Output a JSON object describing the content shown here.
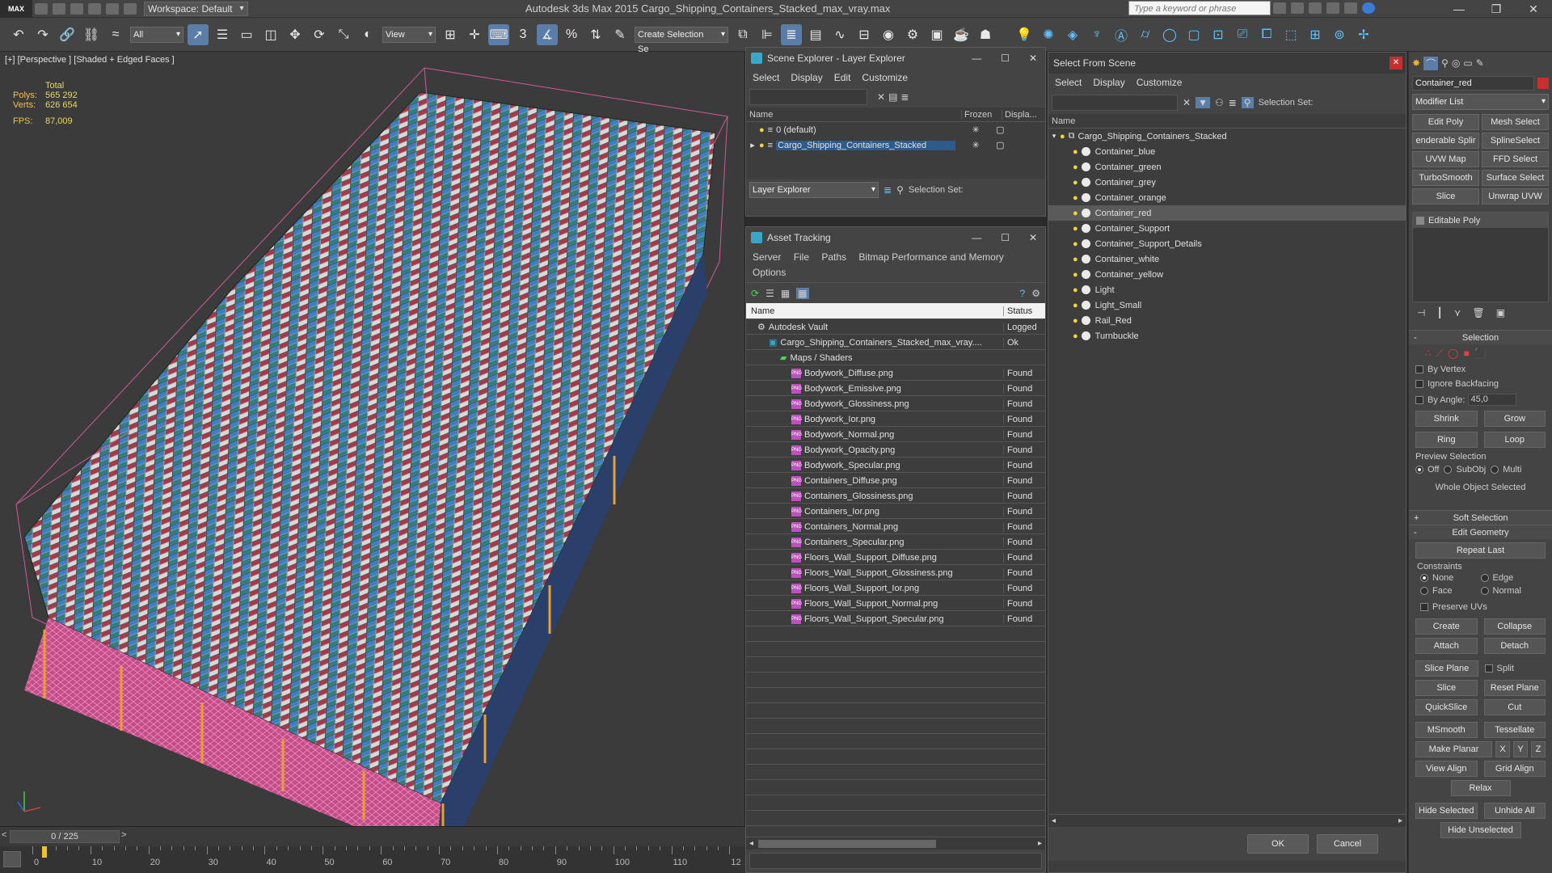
{
  "titlebar": {
    "app_logo": "MAX",
    "workspace": "Workspace: Default",
    "title": "Autodesk 3ds Max  2015      Cargo_Shipping_Containers_Stacked_max_vray.max",
    "search_placeholder": "Type a keyword or phrase"
  },
  "toolbar": {
    "filter_all": "All",
    "ref_coord": "View",
    "selection_set": "Create Selection Se",
    "snap_label": "3"
  },
  "viewport": {
    "label": "[+] [Perspective ] [Shaded + Edged Faces ]",
    "stats": {
      "header": "Total",
      "polys_label": "Polys:",
      "polys_value": "565 292",
      "verts_label": "Verts:",
      "verts_value": "626 654",
      "fps_label": "FPS:",
      "fps_value": "87,009"
    }
  },
  "timeline": {
    "frame": "0 / 225",
    "ticks": [
      "0",
      "10",
      "20",
      "30",
      "40",
      "50",
      "60",
      "70",
      "80",
      "90",
      "100",
      "110",
      "12"
    ]
  },
  "layer_explorer": {
    "title": "Scene Explorer - Layer Explorer",
    "menu": [
      "Select",
      "Display",
      "Edit",
      "Customize"
    ],
    "columns": [
      "Name",
      "Frozen",
      "Displa..."
    ],
    "rows": [
      {
        "name": "0 (default)"
      },
      {
        "name": "Cargo_Shipping_Containers_Stacked"
      }
    ],
    "footer_dropdown": "Layer Explorer",
    "footer_selection": "Selection Set:"
  },
  "asset_tracking": {
    "title": "Asset Tracking",
    "menu": [
      "Server",
      "File",
      "Paths",
      "Bitmap Performance and Memory",
      "Options"
    ],
    "columns": [
      "Name",
      "Status"
    ],
    "rows": [
      {
        "name": "Autodesk Vault",
        "status": "Logged",
        "level": 1,
        "kind": "vault"
      },
      {
        "name": "Cargo_Shipping_Containers_Stacked_max_vray....",
        "status": "Ok",
        "level": 2,
        "kind": "max"
      },
      {
        "name": "Maps / Shaders",
        "status": "",
        "level": 3,
        "kind": "folder"
      },
      {
        "name": "Bodywork_Diffuse.png",
        "status": "Found",
        "level": 4,
        "kind": "png"
      },
      {
        "name": "Bodywork_Emissive.png",
        "status": "Found",
        "level": 4,
        "kind": "png"
      },
      {
        "name": "Bodywork_Glossiness.png",
        "status": "Found",
        "level": 4,
        "kind": "png"
      },
      {
        "name": "Bodywork_Ior.png",
        "status": "Found",
        "level": 4,
        "kind": "png"
      },
      {
        "name": "Bodywork_Normal.png",
        "status": "Found",
        "level": 4,
        "kind": "png"
      },
      {
        "name": "Bodywork_Opacity.png",
        "status": "Found",
        "level": 4,
        "kind": "png"
      },
      {
        "name": "Bodywork_Specular.png",
        "status": "Found",
        "level": 4,
        "kind": "png"
      },
      {
        "name": "Containers_Diffuse.png",
        "status": "Found",
        "level": 4,
        "kind": "png"
      },
      {
        "name": "Containers_Glossiness.png",
        "status": "Found",
        "level": 4,
        "kind": "png"
      },
      {
        "name": "Containers_Ior.png",
        "status": "Found",
        "level": 4,
        "kind": "png"
      },
      {
        "name": "Containers_Normal.png",
        "status": "Found",
        "level": 4,
        "kind": "png"
      },
      {
        "name": "Containers_Specular.png",
        "status": "Found",
        "level": 4,
        "kind": "png"
      },
      {
        "name": "Floors_Wall_Support_Diffuse.png",
        "status": "Found",
        "level": 4,
        "kind": "png"
      },
      {
        "name": "Floors_Wall_Support_Glossiness.png",
        "status": "Found",
        "level": 4,
        "kind": "png"
      },
      {
        "name": "Floors_Wall_Support_Ior.png",
        "status": "Found",
        "level": 4,
        "kind": "png"
      },
      {
        "name": "Floors_Wall_Support_Normal.png",
        "status": "Found",
        "level": 4,
        "kind": "png"
      },
      {
        "name": "Floors_Wall_Support_Specular.png",
        "status": "Found",
        "level": 4,
        "kind": "png"
      }
    ]
  },
  "select_from_scene": {
    "title": "Select From Scene",
    "menu": [
      "Select",
      "Display",
      "Customize"
    ],
    "selection_set": "Selection Set:",
    "column": "Name",
    "root": "Cargo_Shipping_Containers_Stacked",
    "items": [
      "Container_blue",
      "Container_green",
      "Container_grey",
      "Container_orange",
      "Container_red",
      "Container_Support",
      "Container_Support_Details",
      "Container_white",
      "Container_yellow",
      "Light",
      "Light_Small",
      "Rail_Red",
      "Turnbuckle"
    ],
    "selected_index": 4,
    "ok": "OK",
    "cancel": "Cancel"
  },
  "command_panel": {
    "object_name": "Container_red",
    "modifier_list": "Modifier List",
    "mod_buttons": [
      [
        "Edit Poly",
        "Mesh Select"
      ],
      [
        "enderable Splir",
        "SplineSelect"
      ],
      [
        "UVW Map",
        "FFD Select"
      ],
      [
        "TurboSmooth",
        "Surface Select"
      ],
      [
        "Slice",
        "Unwrap UVW"
      ]
    ],
    "stack_item": "Editable Poly",
    "selection_rollout": "Selection",
    "by_vertex": "By Vertex",
    "ignore_backfacing": "Ignore Backfacing",
    "by_angle": "By Angle:",
    "angle_value": "45,0",
    "shrink": "Shrink",
    "grow": "Grow",
    "ring": "Ring",
    "loop": "Loop",
    "preview_selection": "Preview Selection",
    "preview_off": "Off",
    "preview_subobj": "SubObj",
    "preview_multi": "Multi",
    "whole_object": "Whole Object Selected",
    "soft_selection": "Soft Selection",
    "edit_geometry": "Edit Geometry",
    "repeat_last": "Repeat Last",
    "constraints": "Constraints",
    "c_none": "None",
    "c_edge": "Edge",
    "c_face": "Face",
    "c_normal": "Normal",
    "preserve_uvs": "Preserve UVs",
    "create": "Create",
    "collapse": "Collapse",
    "attach": "Attach",
    "detach": "Detach",
    "slice_plane": "Slice Plane",
    "split": "Split",
    "slice": "Slice",
    "reset_plane": "Reset Plane",
    "quickslice": "QuickSlice",
    "cut": "Cut",
    "msmooth": "MSmooth",
    "tessellate": "Tessellate",
    "make_planar": "Make Planar",
    "x": "X",
    "y": "Y",
    "z": "Z",
    "view_align": "View Align",
    "grid_align": "Grid Align",
    "relax": "Relax",
    "hide_selected": "Hide Selected",
    "unhide_all": "Unhide All",
    "hide_unselected": "Hide Unselected"
  },
  "colors": {
    "accent": "#5a7ea8",
    "selection": "#2f5b8c",
    "stats": "#f0c050"
  }
}
